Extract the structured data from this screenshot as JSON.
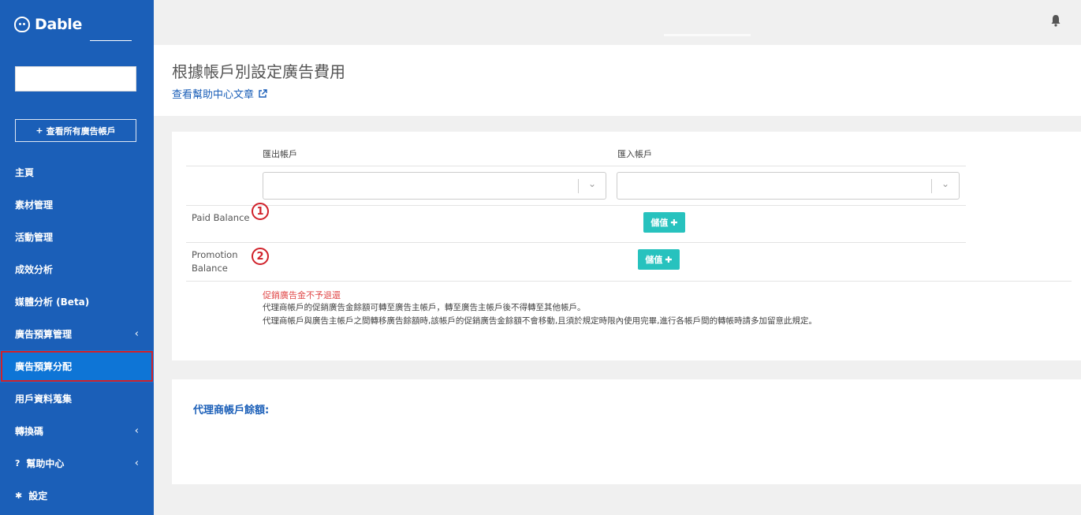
{
  "brand": {
    "name": "Dable",
    "icon": "dable-logo-icon"
  },
  "sidebar": {
    "view_all_label": "查看所有廣告帳戶",
    "items": [
      {
        "label": "主頁",
        "chevron": ""
      },
      {
        "label": "素材管理",
        "chevron": ""
      },
      {
        "label": "活動管理",
        "chevron": ""
      },
      {
        "label": "成效分析",
        "chevron": ""
      },
      {
        "label": "媒體分析 (Beta)",
        "chevron": ""
      },
      {
        "label": "廣告預算管理",
        "chevron": "‹"
      },
      {
        "label": "廣告預算分配",
        "chevron": ""
      },
      {
        "label": "用戶資料蒐集",
        "chevron": ""
      },
      {
        "label": "轉換碼",
        "chevron": "‹"
      },
      {
        "label": "幫助中心",
        "chevron": "‹",
        "icon": "?"
      },
      {
        "label": "設定",
        "chevron": "",
        "icon": "✱"
      }
    ]
  },
  "header": {
    "title": "根據帳戶別設定廣告費用",
    "help_link": "查看幫助中心文章"
  },
  "transfer": {
    "export_label": "匯出帳戶",
    "import_label": "匯入帳戶",
    "export_select_value": "",
    "import_select_value": "",
    "paid_balance_label": "Paid Balance",
    "promotion_balance_label_line1": "Promotion",
    "promotion_balance_label_line2": "Balance",
    "marker_1": "1",
    "marker_2": "2",
    "charge_button_label": "儲值",
    "note_red": "促銷廣告金不予退還",
    "note_line1": "代理商帳戶的促銷廣告金餘額可轉至廣告主帳戶，轉至廣告主帳戶後不得轉至其他帳戶。",
    "note_line2": "代理商帳戶與廣告主帳戶之間轉移廣告餘額時,該帳戶的促銷廣告金餘額不會移動,且須於規定時限內使用完畢,進行各帳戶間的轉帳時請多加留意此規定。"
  },
  "agency": {
    "label": "代理商帳戶餘額:"
  },
  "colors": {
    "sidebar": "#1b5fb8",
    "active": "#0e75d6",
    "highlight": "#d0212a",
    "charge": "#27c2be"
  }
}
